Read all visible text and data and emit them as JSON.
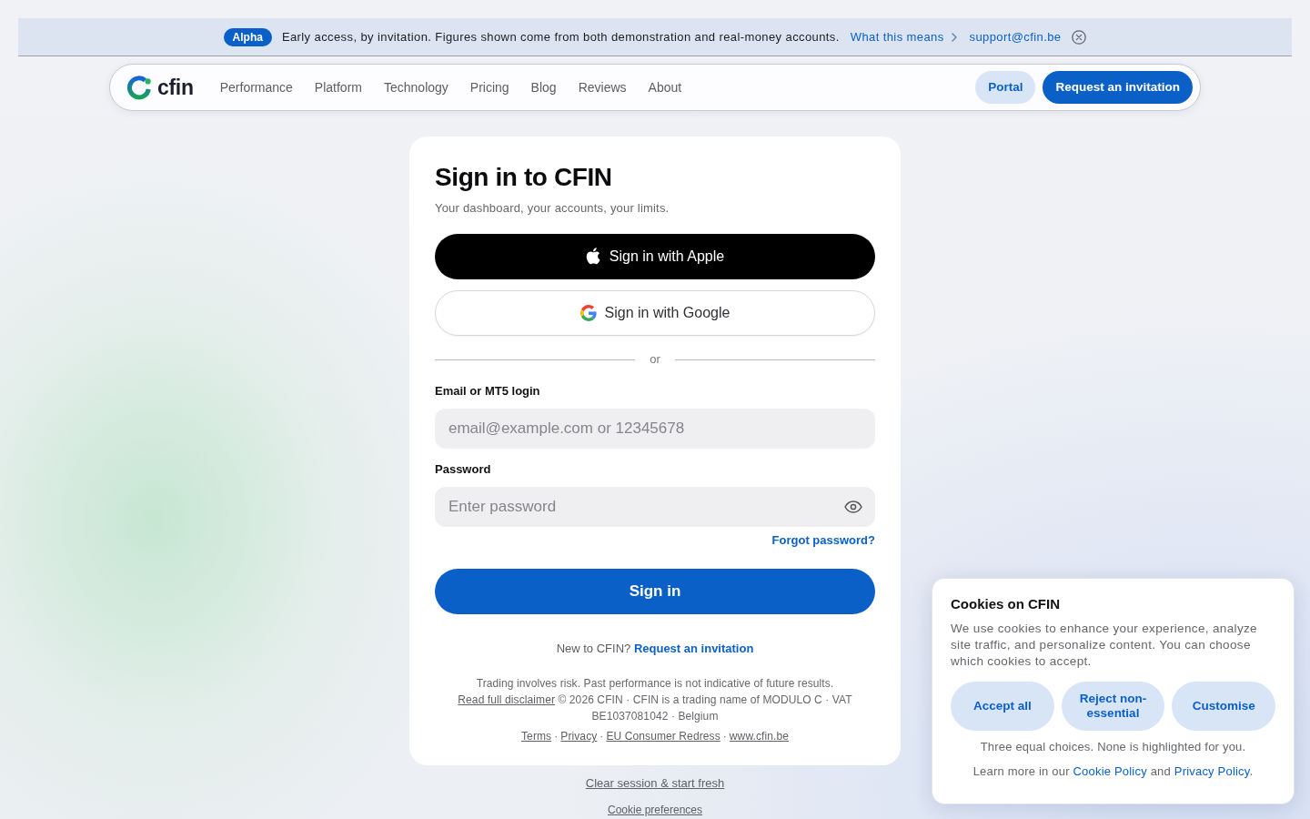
{
  "banner": {
    "badge": "Alpha",
    "message": "Early access, by invitation. Figures shown come from both demonstration and real-money accounts.",
    "link": "What this means",
    "email": "support@cfin.be"
  },
  "nav": {
    "logo": "cfin",
    "links": [
      {
        "label": "Performance"
      },
      {
        "label": "Platform"
      },
      {
        "label": "Technology"
      },
      {
        "label": "Pricing"
      },
      {
        "label": "Blog"
      },
      {
        "label": "Reviews"
      },
      {
        "label": "About"
      }
    ],
    "actions": [
      {
        "label": "Portal",
        "kind": "secondary"
      },
      {
        "label": "Request an invitation",
        "kind": "primary"
      }
    ]
  },
  "sign_in": {
    "title": "Sign in to CFIN",
    "subtitle": "Your dashboard, your accounts, your limits.",
    "providers": [
      {
        "label": "Sign in with Apple",
        "kind": "apple"
      },
      {
        "label": "Sign in with Google",
        "kind": "google"
      }
    ],
    "divider": "or",
    "fields": [
      {
        "kind": "text",
        "label": "Email or MT5 login",
        "placeholder": "email@example.com or 12345678"
      },
      {
        "kind": "password",
        "label": "Password",
        "placeholder": "Enter password"
      }
    ],
    "forgot_link": "Forgot password?",
    "submit": "Sign in",
    "prompt": "New to CFIN?",
    "prompt_link": "Request an invitation",
    "risk": "Trading involves risk. Past performance is not indicative of future results.",
    "disclaimer_link": "Read full disclaimer",
    "legal": "© 2026 CFIN · CFIN is a trading name of MODULO C · VAT BE1037081042 · Belgium",
    "footer_links": [
      "Terms",
      "Privacy",
      "EU Consumer Redress",
      "www.cfin.be"
    ],
    "separator": "·"
  },
  "below_card": [
    "Clear session & start fresh",
    "Cookie preferences"
  ],
  "cookies": {
    "title": "Cookies on CFIN",
    "text": "We use cookies to enhance your experience, analyze site traffic, and personalize content. You can choose which cookies to accept.",
    "buttons": [
      "Accept all",
      "Reject non-essential",
      "Customise"
    ],
    "note": "Three equal choices. None is highlighted for you.",
    "learn_more": {
      "before": "Learn more in our",
      "links": [
        "Cookie Policy",
        "Privacy Policy"
      ],
      "between": "and",
      "after": "."
    }
  }
}
